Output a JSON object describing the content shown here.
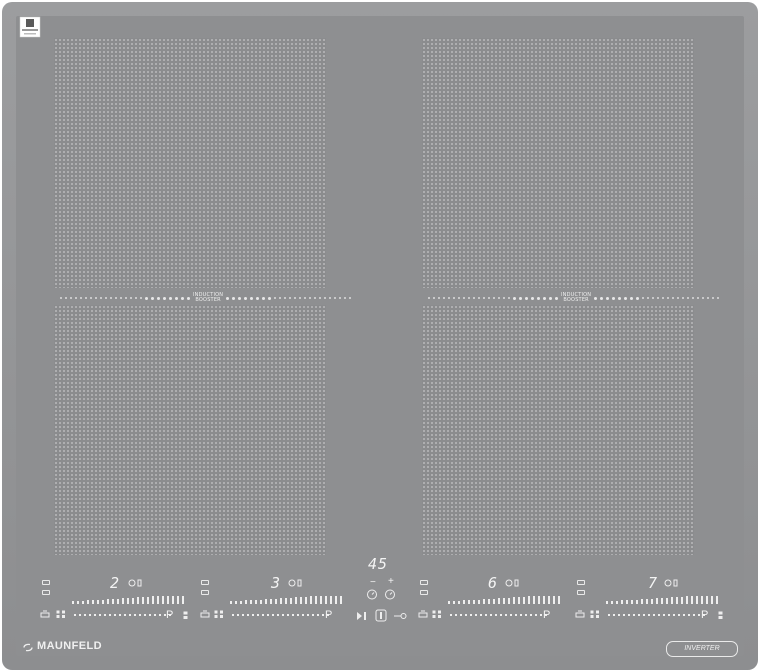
{
  "cooktop": {
    "brand": "MAUNFELD",
    "inverter_badge": "INVERTER",
    "booster_label_line1": "INDUCTION",
    "booster_label_line2": "BOOSTER",
    "timer_display": "45",
    "timer_minus": "−",
    "timer_plus": "+",
    "zones": [
      {
        "label": "zone-front-left",
        "level": "2",
        "pause_label": "P"
      },
      {
        "label": "zone-rear-left",
        "level": "3",
        "pause_label": "P"
      },
      {
        "label": "zone-front-right",
        "level": "6",
        "pause_label": "P"
      },
      {
        "label": "zone-rear-right",
        "level": "7",
        "pause_label": "P"
      }
    ]
  },
  "colors": {
    "frame": "#9c9d9f",
    "glass": "#8e8f91",
    "zone_pattern": "#b6b7b9",
    "indicator": "#f4f4f4"
  }
}
